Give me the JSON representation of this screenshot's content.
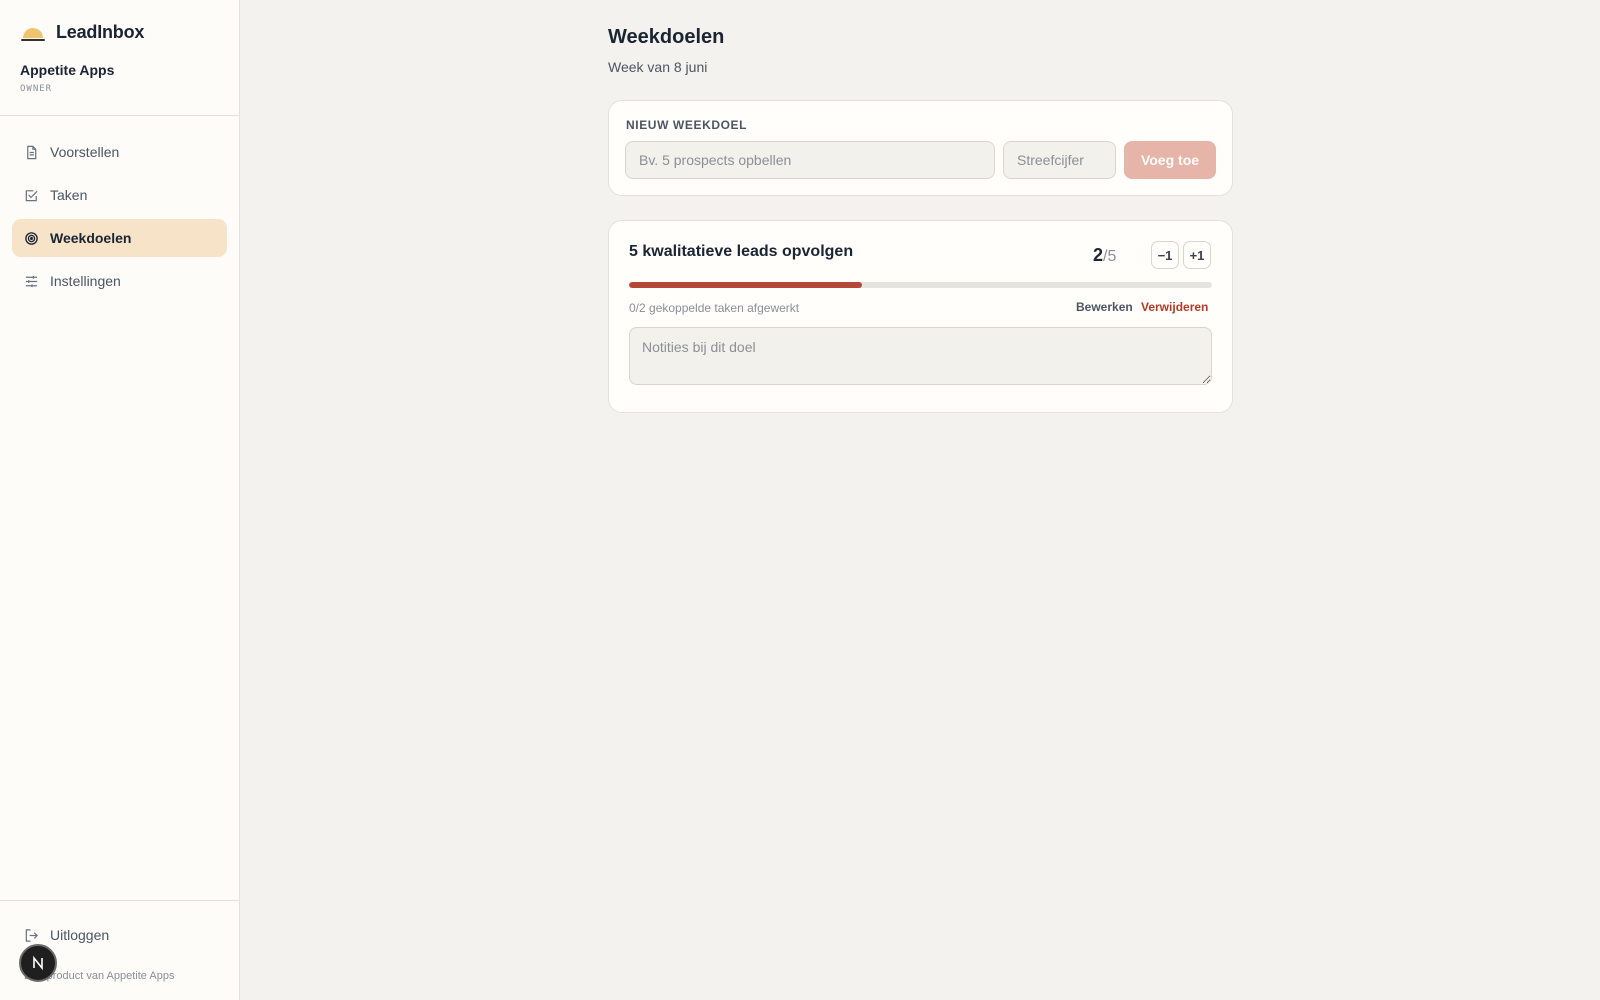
{
  "app": {
    "name": "LeadInbox"
  },
  "org": {
    "name": "Appetite Apps",
    "role": "OWNER"
  },
  "nav": {
    "items": [
      {
        "label": "Voorstellen",
        "icon": "document-icon"
      },
      {
        "label": "Taken",
        "icon": "checkbox-icon"
      },
      {
        "label": "Weekdoelen",
        "icon": "target-icon",
        "active": true
      },
      {
        "label": "Instellingen",
        "icon": "sliders-icon"
      }
    ]
  },
  "logout": {
    "label": "Uitloggen"
  },
  "footer": {
    "text": "Een product van Appetite Apps"
  },
  "fab": {
    "letter": "N"
  },
  "page": {
    "title": "Weekdoelen",
    "subtitle": "Week van 8 juni"
  },
  "new_goal": {
    "label": "NIEUW WEEKDOEL",
    "goal_placeholder": "Bv. 5 prospects opbellen",
    "target_placeholder": "Streefcijfer",
    "add_label": "Voeg toe"
  },
  "goal": {
    "title": "5 kwalitatieve leads opvolgen",
    "current": "2",
    "separator": "/",
    "target": "5",
    "progress_fraction": 0.4,
    "minus_label": "−1",
    "plus_label": "+1",
    "linked_tasks": "0/2 gekoppelde taken afgewerkt",
    "edit_label": "Bewerken",
    "delete_label": "Verwijderen",
    "notes_placeholder": "Notities bij dit doel"
  },
  "colors": {
    "accent": "#b6483a",
    "active_nav": "#f6e3c8",
    "add_button": "#e6b4a8"
  }
}
